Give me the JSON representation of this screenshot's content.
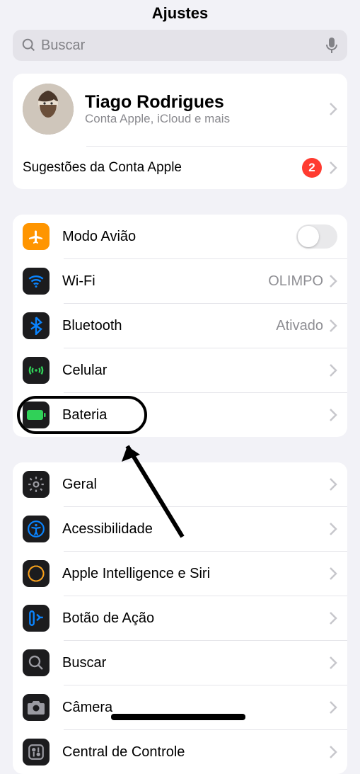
{
  "header": {
    "title": "Ajustes"
  },
  "search": {
    "placeholder": "Buscar"
  },
  "account": {
    "name": "Tiago Rodrigues",
    "subtitle": "Conta Apple, iCloud e mais",
    "suggestions_label": "Sugestões da Conta Apple",
    "suggestions_count": "2"
  },
  "group1": {
    "airplane": {
      "label": "Modo Avião"
    },
    "wifi": {
      "label": "Wi-Fi",
      "value": "OLIMPO"
    },
    "bluetooth": {
      "label": "Bluetooth",
      "value": "Ativado"
    },
    "cellular": {
      "label": "Celular"
    },
    "battery": {
      "label": "Bateria"
    }
  },
  "group2": {
    "general": {
      "label": "Geral"
    },
    "accessibility": {
      "label": "Acessibilidade"
    },
    "ai": {
      "label": "Apple Intelligence e Siri"
    },
    "action": {
      "label": "Botão de Ação"
    },
    "search": {
      "label": "Buscar"
    },
    "camera": {
      "label": "Câmera"
    },
    "control": {
      "label": "Central de Controle"
    }
  }
}
